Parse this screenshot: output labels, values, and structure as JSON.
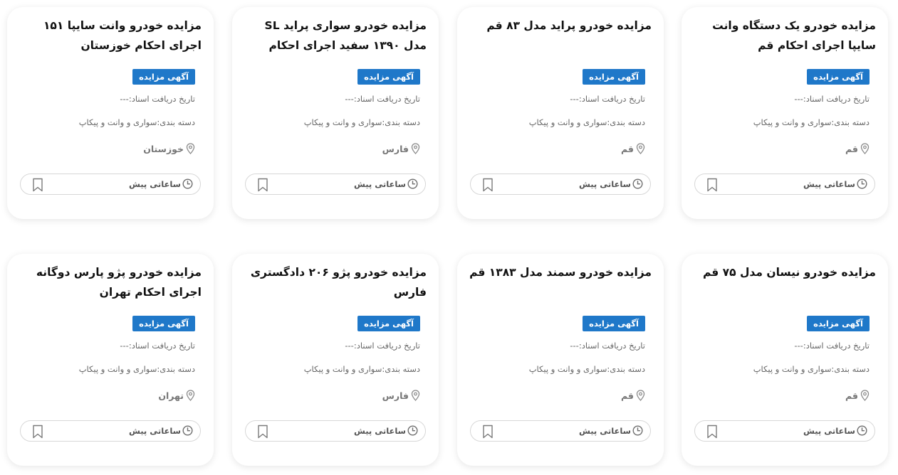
{
  "badge_label": "آگهی مزایده",
  "date_label": "تاریخ دریافت اسناد:---",
  "category_label": "دسته بندی:سواری و وانت و پیکاپ",
  "time_label": "ساعاتی پیش",
  "icons": {
    "location": "location-pin-icon",
    "time": "clock-icon",
    "save": "bookmark-icon"
  },
  "colors": {
    "badge": "#1f78c9",
    "title": "#111111",
    "meta": "#666666"
  },
  "cards": [
    {
      "title": "مزایده خودرو یک دستگاه وانت سایپا اجرای احکام قم",
      "location": "قم"
    },
    {
      "title": "مزایده خودرو پراید مدل ۸۳ قم",
      "location": "قم"
    },
    {
      "title": "مزایده خودرو سواری پراید SL مدل ۱۳۹۰ سفید اجرای احکام فارس",
      "location": "فارس"
    },
    {
      "title": "مزایده خودرو وانت سایپا ۱۵۱ اجرای احکام خوزستان",
      "location": "خوزستان"
    },
    {
      "title": "مزایده خودرو نیسان مدل ۷۵ قم",
      "location": "قم"
    },
    {
      "title": "مزایده خودرو سمند مدل ۱۳۸۳ قم",
      "location": "قم"
    },
    {
      "title": "مزایده خودرو پژو ۲۰۶ دادگستری فارس",
      "location": "فارس"
    },
    {
      "title": "مزایده خودرو پژو پارس دوگانه اجرای احکام تهران",
      "location": "تهران"
    }
  ]
}
